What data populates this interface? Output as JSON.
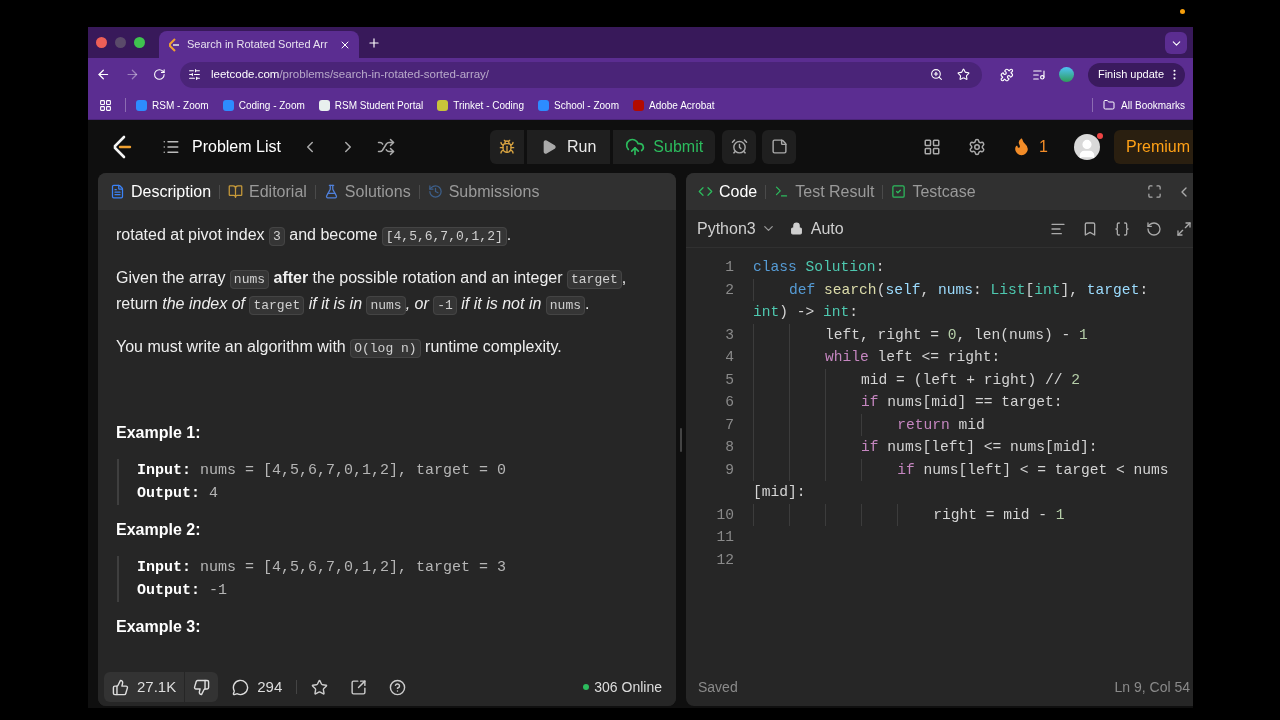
{
  "browser": {
    "tab": {
      "title": "Search in Rotated Sorted Arr"
    },
    "url": {
      "host": "leetcode.com",
      "path": "/problems/search-in-rotated-sorted-array/"
    },
    "update_button": "Finish update",
    "bookmarks": [
      {
        "label": "RSM - Zoom",
        "color": "#2d8cff"
      },
      {
        "label": "Coding - Zoom",
        "color": "#2d8cff"
      },
      {
        "label": "RSM Student Portal",
        "color": "#e8f0ee"
      },
      {
        "label": "Trinket - Coding",
        "color": "#c8c43a"
      },
      {
        "label": "School - Zoom",
        "color": "#2d8cff"
      },
      {
        "label": "Adobe Acrobat",
        "color": "#b30b00"
      }
    ],
    "all_bookmarks": "All Bookmarks"
  },
  "nav": {
    "problem_list": "Problem List",
    "run": "Run",
    "submit": "Submit",
    "streak": "1",
    "premium": "Premium"
  },
  "left_panel": {
    "tabs": [
      {
        "label": "Description",
        "selected": true
      },
      {
        "label": "Editorial",
        "selected": false
      },
      {
        "label": "Solutions",
        "selected": false
      },
      {
        "label": "Submissions",
        "selected": false
      }
    ],
    "paragraphs": [
      [
        {
          "kind": "text",
          "text": "rotated at pivot index "
        },
        {
          "kind": "code",
          "text": "3"
        },
        {
          "kind": "text",
          "text": " and become "
        },
        {
          "kind": "code",
          "text": "[4,5,6,7,0,1,2]"
        },
        {
          "kind": "text",
          "text": "."
        }
      ],
      [
        {
          "kind": "text",
          "text": "Given the array "
        },
        {
          "kind": "code",
          "text": "nums"
        },
        {
          "kind": "bold",
          "text": " after"
        },
        {
          "kind": "text",
          "text": " the possible rotation and an integer "
        },
        {
          "kind": "code",
          "text": "target"
        },
        {
          "kind": "text",
          "text": ", return "
        },
        {
          "kind": "italic",
          "text": "the index of "
        },
        {
          "kind": "code",
          "text": "target"
        },
        {
          "kind": "italic",
          "text": " if it is in "
        },
        {
          "kind": "code",
          "text": "nums"
        },
        {
          "kind": "italic",
          "text": ", or "
        },
        {
          "kind": "code",
          "text": "-1"
        },
        {
          "kind": "italic",
          "text": " if it is not in "
        },
        {
          "kind": "code",
          "text": "nums"
        },
        {
          "kind": "text",
          "text": "."
        }
      ],
      [
        {
          "kind": "text",
          "text": "You must write an algorithm with "
        },
        {
          "kind": "code",
          "text": "O(log n)"
        },
        {
          "kind": "text",
          "text": " runtime complexity."
        }
      ]
    ],
    "examples": [
      {
        "title": "Example 1:",
        "input_label": "Input:",
        "input": "nums = [4,5,6,7,0,1,2], target = 0",
        "output_label": "Output:",
        "output": "4"
      },
      {
        "title": "Example 2:",
        "input_label": "Input:",
        "input": "nums = [4,5,6,7,0,1,2], target = 3",
        "output_label": "Output:",
        "output": "-1"
      },
      {
        "title": "Example 3:"
      }
    ],
    "footer": {
      "likes": "27.1K",
      "comments": "294",
      "online": "306 Online"
    }
  },
  "right_panel": {
    "tabs": [
      {
        "label": "Code",
        "selected": true
      },
      {
        "label": "Test Result",
        "selected": false
      },
      {
        "label": "Testcase",
        "selected": false
      }
    ],
    "language": "Python3",
    "mode": "Auto",
    "code": [
      {
        "number": "1",
        "rows": [
          [
            {
              "kind": "keyword",
              "text": "class"
            },
            {
              "kind": "plain",
              "text": " "
            },
            {
              "kind": "class",
              "text": "Solution"
            },
            {
              "kind": "plain",
              "text": ":"
            }
          ]
        ]
      },
      {
        "number": "2",
        "rows": [
          [
            {
              "kind": "plain",
              "text": "    "
            },
            {
              "kind": "keyword",
              "text": "def"
            },
            {
              "kind": "plain",
              "text": " "
            },
            {
              "kind": "function",
              "text": "search"
            },
            {
              "kind": "plain",
              "text": "("
            },
            {
              "kind": "param",
              "text": "self"
            },
            {
              "kind": "plain",
              "text": ", "
            },
            {
              "kind": "param",
              "text": "nums"
            },
            {
              "kind": "plain",
              "text": ": "
            },
            {
              "kind": "type",
              "text": "List"
            },
            {
              "kind": "plain",
              "text": "["
            },
            {
              "kind": "type",
              "text": "int"
            },
            {
              "kind": "plain",
              "text": "], "
            },
            {
              "kind": "param",
              "text": "target"
            },
            {
              "kind": "plain",
              "text": ":"
            }
          ],
          [
            {
              "kind": "type",
              "text": "int"
            },
            {
              "kind": "plain",
              "text": ") -> "
            },
            {
              "kind": "type",
              "text": "int"
            },
            {
              "kind": "plain",
              "text": ":"
            }
          ]
        ]
      },
      {
        "number": "3",
        "rows": [
          [
            {
              "kind": "plain",
              "text": "        left, right = "
            },
            {
              "kind": "number",
              "text": "0"
            },
            {
              "kind": "plain",
              "text": ", len(nums) - "
            },
            {
              "kind": "number",
              "text": "1"
            }
          ]
        ]
      },
      {
        "number": "4",
        "rows": [
          [
            {
              "kind": "plain",
              "text": "        "
            },
            {
              "kind": "control",
              "text": "while"
            },
            {
              "kind": "plain",
              "text": " left <= right:"
            }
          ]
        ]
      },
      {
        "number": "5",
        "rows": [
          [
            {
              "kind": "plain",
              "text": "            mid = (left + right) // "
            },
            {
              "kind": "number",
              "text": "2"
            }
          ]
        ]
      },
      {
        "number": "6",
        "rows": [
          [
            {
              "kind": "plain",
              "text": "            "
            },
            {
              "kind": "control",
              "text": "if"
            },
            {
              "kind": "plain",
              "text": " nums[mid] == target:"
            }
          ]
        ]
      },
      {
        "number": "7",
        "rows": [
          [
            {
              "kind": "plain",
              "text": "                "
            },
            {
              "kind": "control",
              "text": "return"
            },
            {
              "kind": "plain",
              "text": " mid"
            }
          ]
        ]
      },
      {
        "number": "8",
        "rows": [
          [
            {
              "kind": "plain",
              "text": "            "
            },
            {
              "kind": "control",
              "text": "if"
            },
            {
              "kind": "plain",
              "text": " nums[left] <= nums[mid]:"
            }
          ]
        ]
      },
      {
        "number": "9",
        "rows": [
          [
            {
              "kind": "plain",
              "text": "                "
            },
            {
              "kind": "control",
              "text": "if"
            },
            {
              "kind": "plain",
              "text": " nums[left] < = target < nums"
            }
          ],
          [
            {
              "kind": "plain",
              "text": "[mid]:"
            }
          ]
        ]
      },
      {
        "number": "10",
        "rows": [
          [
            {
              "kind": "plain",
              "text": "                    right = mid - "
            },
            {
              "kind": "number",
              "text": "1"
            }
          ]
        ]
      },
      {
        "number": "11",
        "rows": [
          []
        ]
      },
      {
        "number": "12",
        "rows": [
          []
        ]
      }
    ],
    "status": "Saved",
    "cursor": "Ln 9, Col 54"
  }
}
